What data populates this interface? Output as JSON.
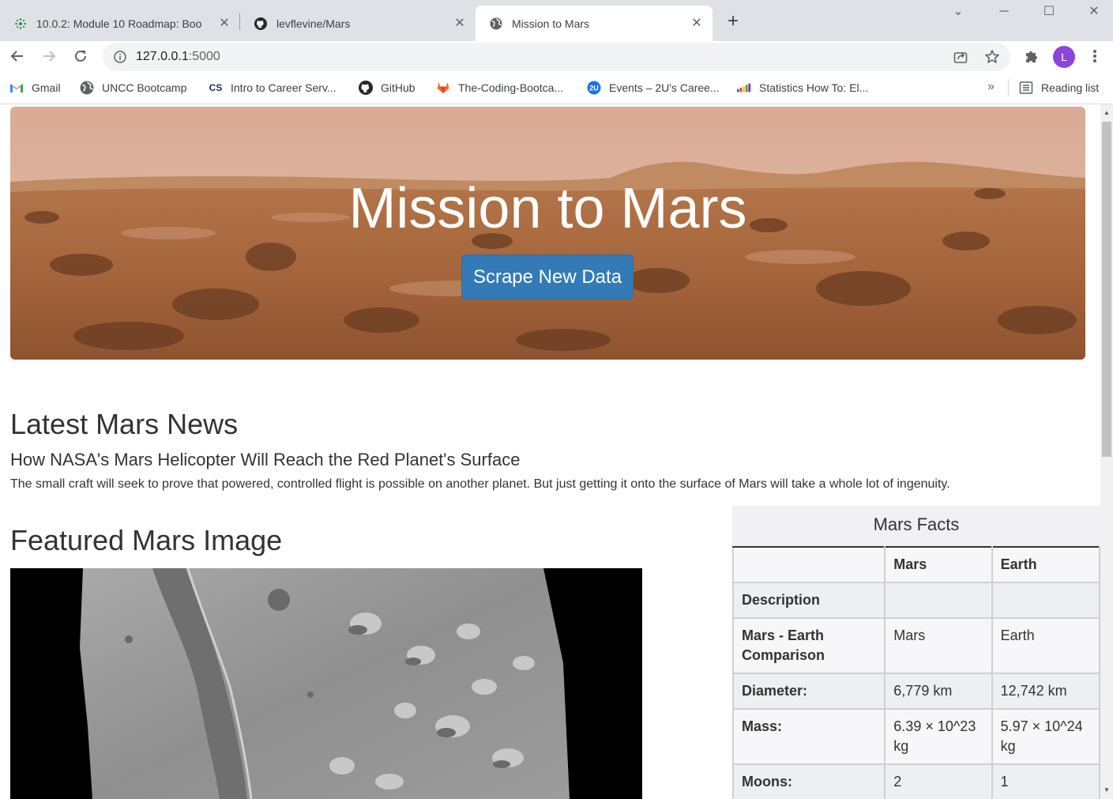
{
  "browser": {
    "tabs": [
      {
        "title": "10.0.2: Module 10 Roadmap: Boo",
        "favicon": "canvas-icon",
        "active": false
      },
      {
        "title": "levflevine/Mars",
        "favicon": "github-icon",
        "active": false
      },
      {
        "title": "Mission to Mars",
        "favicon": "globe-icon",
        "active": true
      }
    ],
    "url_host": "127.0.0.1",
    "url_port": ":5000",
    "profile_initial": "L",
    "bookmarks": [
      {
        "label": "Gmail",
        "icon": "gmail-icon"
      },
      {
        "label": "UNCC Bootcamp",
        "icon": "globe-icon"
      },
      {
        "label": "Intro to Career Serv...",
        "icon": "cs-icon"
      },
      {
        "label": "GitHub",
        "icon": "github-icon"
      },
      {
        "label": "The-Coding-Bootca...",
        "icon": "gitlab-icon"
      },
      {
        "label": "Events – 2U's Caree...",
        "icon": "2u-icon"
      },
      {
        "label": "Statistics How To: El...",
        "icon": "stats-icon"
      }
    ],
    "overflow_chevron": "»",
    "reading_list": "Reading list"
  },
  "page": {
    "hero_title": "Mission to Mars",
    "scrape_button": "Scrape New Data",
    "news_heading": "Latest Mars News",
    "news_title": "How NASA's Mars Helicopter Will Reach the Red Planet's Surface",
    "news_paragraph": "The small craft will seek to prove that powered, controlled flight is possible on another planet. But just getting it onto the surface of Mars will take a whole lot of ingenuity.",
    "featured_heading": "Featured Mars Image",
    "facts": {
      "caption": "Mars Facts",
      "header": [
        "",
        "Mars",
        "Earth"
      ],
      "rows": [
        [
          "Description",
          "",
          ""
        ],
        [
          "Mars - Earth Comparison",
          "Mars",
          "Earth"
        ],
        [
          "Diameter:",
          "6,779 km",
          "12,742 km"
        ],
        [
          "Mass:",
          "6.39 × 10^23 kg",
          "5.97 × 10^24 kg"
        ],
        [
          "Moons:",
          "2",
          "1"
        ]
      ]
    }
  },
  "colors": {
    "button_blue": "#337ab7",
    "tabstrip_bg": "#dee1e6",
    "profile_purple": "#8e44d9"
  }
}
